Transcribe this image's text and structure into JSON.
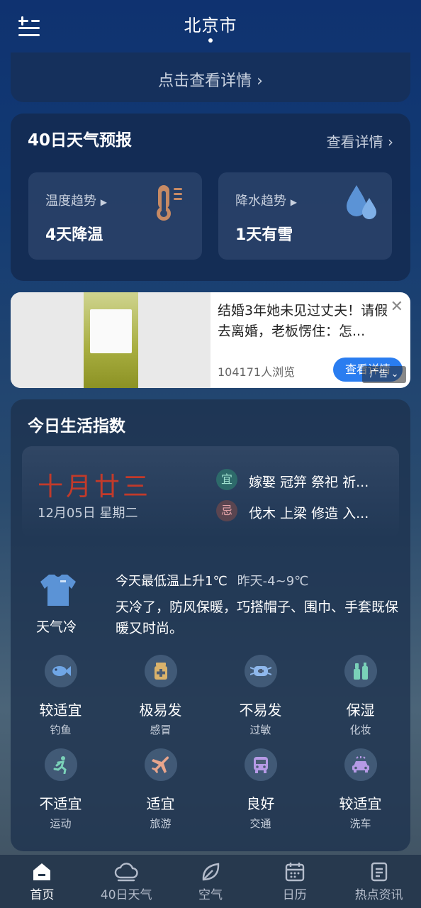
{
  "header": {
    "city": "北京市",
    "menu_icon": "menu-add-icon"
  },
  "detail_banner": {
    "link_text": "点击查看详情"
  },
  "forecast": {
    "title": "40日天气预报",
    "more": "查看详情",
    "temperature": {
      "label": "温度趋势",
      "value": "4天降温",
      "icon": "thermometer-icon"
    },
    "precipitation": {
      "label": "降水趋势",
      "value": "1天有雪",
      "icon": "raindrops-icon"
    }
  },
  "ad": {
    "title": "结婚3年她未见过丈夫！请假去离婚，老板愣住：怎...",
    "views": "104171人浏览",
    "button": "查看详情",
    "badge": "广告"
  },
  "life": {
    "title": "今日生活指数",
    "lunar_date": "十月廿三",
    "solar_date": "12月05日 星期二",
    "yi_badge": "宜",
    "yi_text": "嫁娶 冠笄 祭祀 祈...",
    "ji_badge": "忌",
    "ji_text": "伐木 上梁 修造 入...",
    "clothing_label": "天气冷",
    "temp_change": "今天最低温上升1℃",
    "yesterday": "昨天-4~9℃",
    "advice": "天冷了，防风保暖，巧搭帽子、围巾、手套既保暖又时尚。",
    "indices": [
      {
        "value": "较适宜",
        "name": "钓鱼",
        "icon": "fish-icon"
      },
      {
        "value": "极易发",
        "name": "感冒",
        "icon": "medicine-icon"
      },
      {
        "value": "不易发",
        "name": "过敏",
        "icon": "mask-icon"
      },
      {
        "value": "保湿",
        "name": "化妆",
        "icon": "cosmetics-icon"
      },
      {
        "value": "不适宜",
        "name": "运动",
        "icon": "running-icon"
      },
      {
        "value": "适宜",
        "name": "旅游",
        "icon": "airplane-icon"
      },
      {
        "value": "良好",
        "name": "交通",
        "icon": "bus-icon"
      },
      {
        "value": "较适宜",
        "name": "洗车",
        "icon": "car-wash-icon"
      }
    ]
  },
  "nav": [
    {
      "label": "首页",
      "icon": "home-icon",
      "active": true
    },
    {
      "label": "40日天气",
      "icon": "cloud-icon"
    },
    {
      "label": "空气",
      "icon": "leaf-icon"
    },
    {
      "label": "日历",
      "icon": "calendar-icon"
    },
    {
      "label": "热点资讯",
      "icon": "news-icon"
    }
  ],
  "colors": {
    "accent": "#2a7df0",
    "lunar_red": "#c23a2a",
    "yi_green": "#9fe0cf",
    "ji_red": "#e3a3a8"
  }
}
